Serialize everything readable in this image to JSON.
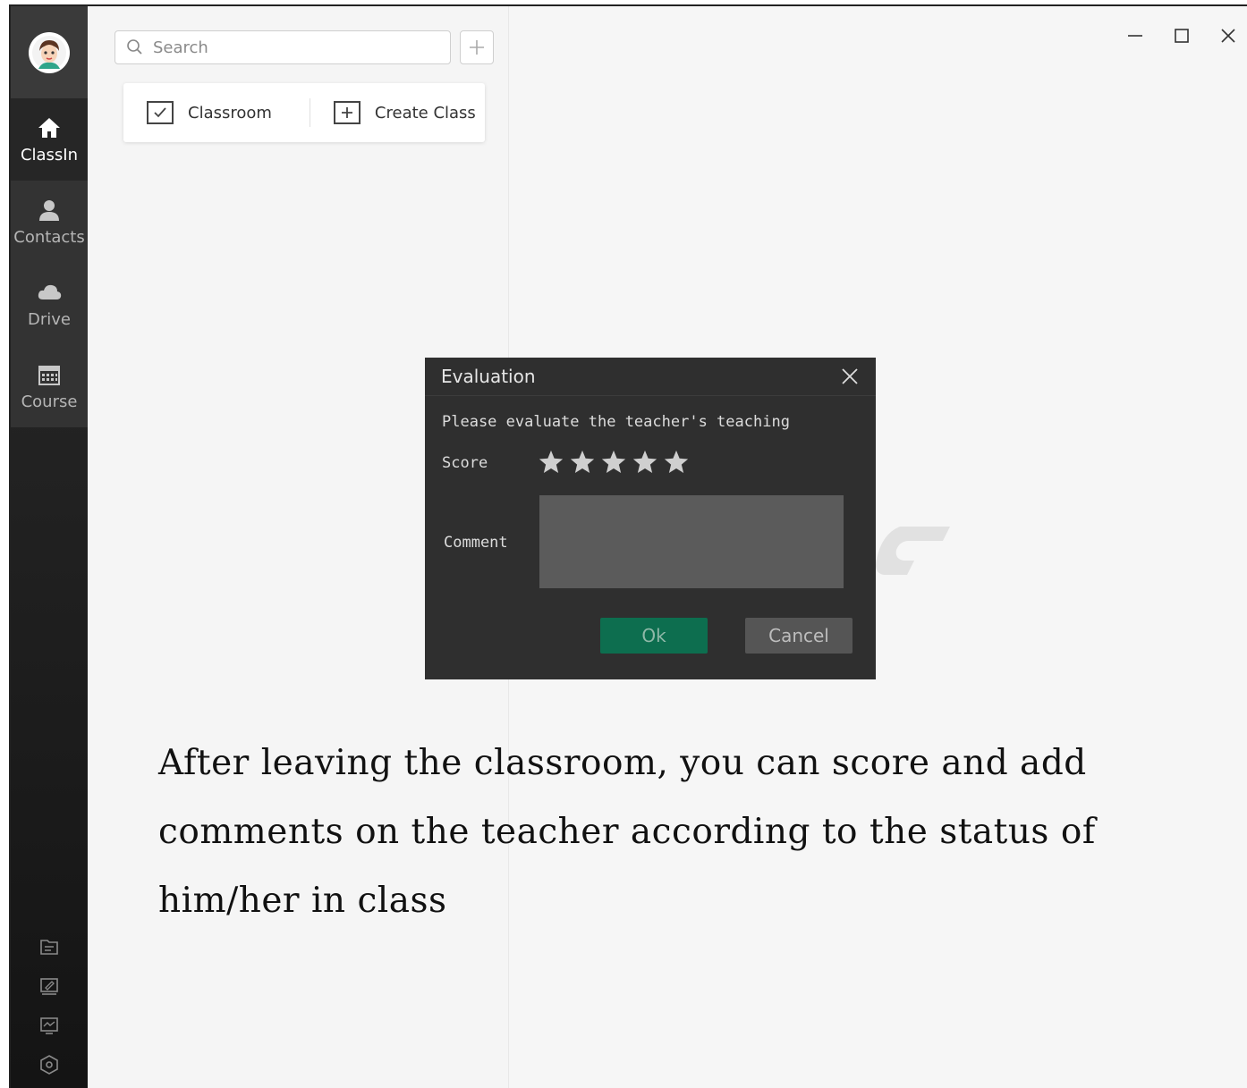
{
  "sidebar": {
    "items": [
      {
        "label": "ClassIn",
        "icon": "home-icon"
      },
      {
        "label": "Contacts",
        "icon": "contacts-icon"
      },
      {
        "label": "Drive",
        "icon": "cloud-icon"
      },
      {
        "label": "Course",
        "icon": "calendar-icon"
      }
    ],
    "bottom_icons": [
      "folder-icon",
      "edit-icon",
      "monitor-icon",
      "settings-icon"
    ]
  },
  "search": {
    "placeholder": "Search"
  },
  "actions": {
    "classroom_label": "Classroom",
    "create_class_label": "Create Class"
  },
  "dialog": {
    "title": "Evaluation",
    "prompt": "Please evaluate the teacher's teaching",
    "score_label": "Score",
    "score_max": 5,
    "comment_label": "Comment",
    "comment_value": "",
    "ok_label": "Ok",
    "cancel_label": "Cancel"
  },
  "caption": {
    "line1": "After leaving the classroom, you can score and add",
    "line2": "comments on the teacher according to the status of",
    "line3": "him/her in class"
  },
  "colors": {
    "sidebar_bg": "#1e1e1e",
    "dialog_bg": "#2f2f2f",
    "ok_button": "#0d6e4f",
    "cancel_button": "#555555"
  }
}
